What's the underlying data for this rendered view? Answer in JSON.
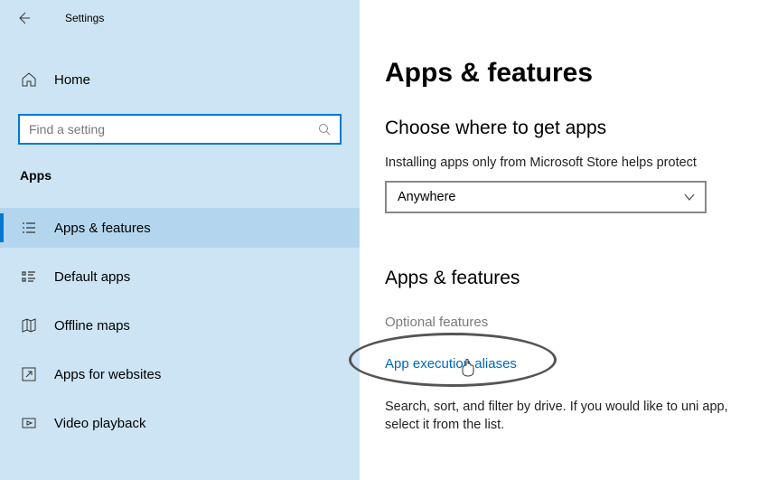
{
  "window": {
    "title": "Settings"
  },
  "sidebar": {
    "home_label": "Home",
    "search_placeholder": "Find a setting",
    "section_label": "Apps",
    "items": [
      {
        "label": "Apps & features",
        "selected": true
      },
      {
        "label": "Default apps"
      },
      {
        "label": "Offline maps"
      },
      {
        "label": "Apps for websites"
      },
      {
        "label": "Video playback"
      }
    ]
  },
  "main": {
    "title": "Apps & features",
    "choose_heading": "Choose where to get apps",
    "choose_desc": "Installing apps only from Microsoft Store helps protect",
    "choose_value": "Anywhere",
    "section2_heading": "Apps & features",
    "optional_features": "Optional features",
    "app_exec_aliases": "App execution aliases",
    "body": "Search, sort, and filter by drive. If you would like to uni app, select it from the list."
  }
}
